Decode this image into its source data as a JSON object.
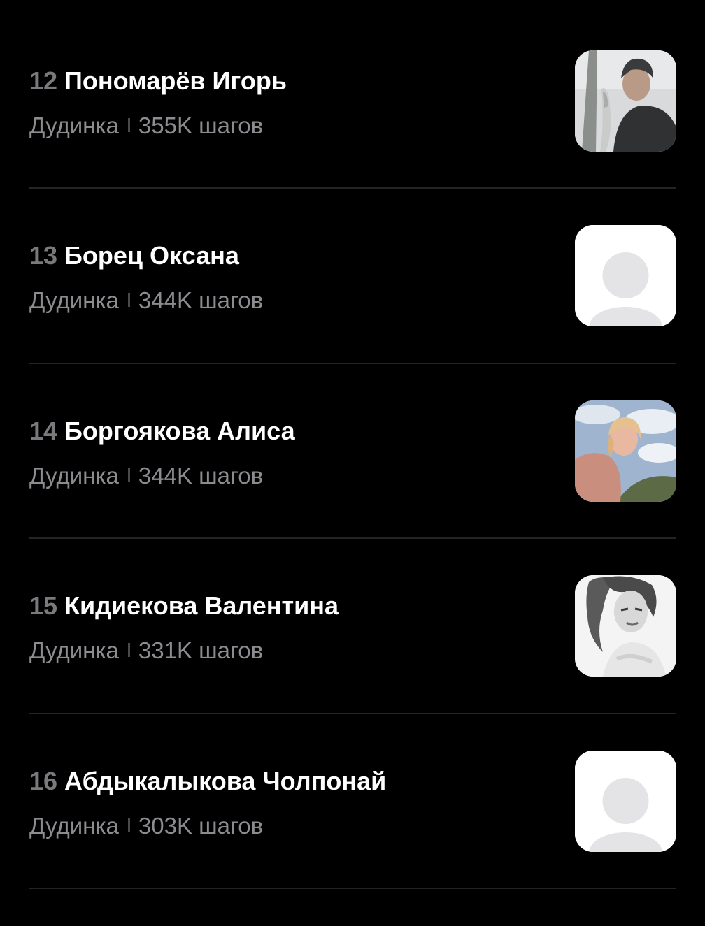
{
  "colors": {
    "background": "#000000",
    "name_text": "#ffffff",
    "rank_text": "#7a7a7e",
    "secondary_text": "#8c8c90",
    "divider": "#242426",
    "placeholder_avatar_bg": "#ffffff",
    "placeholder_avatar_figure": "#e4e4e6"
  },
  "entries": [
    {
      "rank": "12",
      "name": "Пономарёв Игорь",
      "city": "Дудинка",
      "steps": "355K шагов",
      "avatar": "photo-man-with-fish"
    },
    {
      "rank": "13",
      "name": "Борец Оксана",
      "city": "Дудинка",
      "steps": "344K шагов",
      "avatar": "placeholder-person"
    },
    {
      "rank": "14",
      "name": "Боргоякова Алиса",
      "city": "Дудинка",
      "steps": "344K шагов",
      "avatar": "photo-woman-sky"
    },
    {
      "rank": "15",
      "name": "Кидиекова Валентина",
      "city": "Дудинка",
      "steps": "331K шагов",
      "avatar": "photo-woman-portrait-bw"
    },
    {
      "rank": "16",
      "name": "Абдыкалыкова Чолпонай",
      "city": "Дудинка",
      "steps": "303K шагов",
      "avatar": "placeholder-person"
    }
  ]
}
